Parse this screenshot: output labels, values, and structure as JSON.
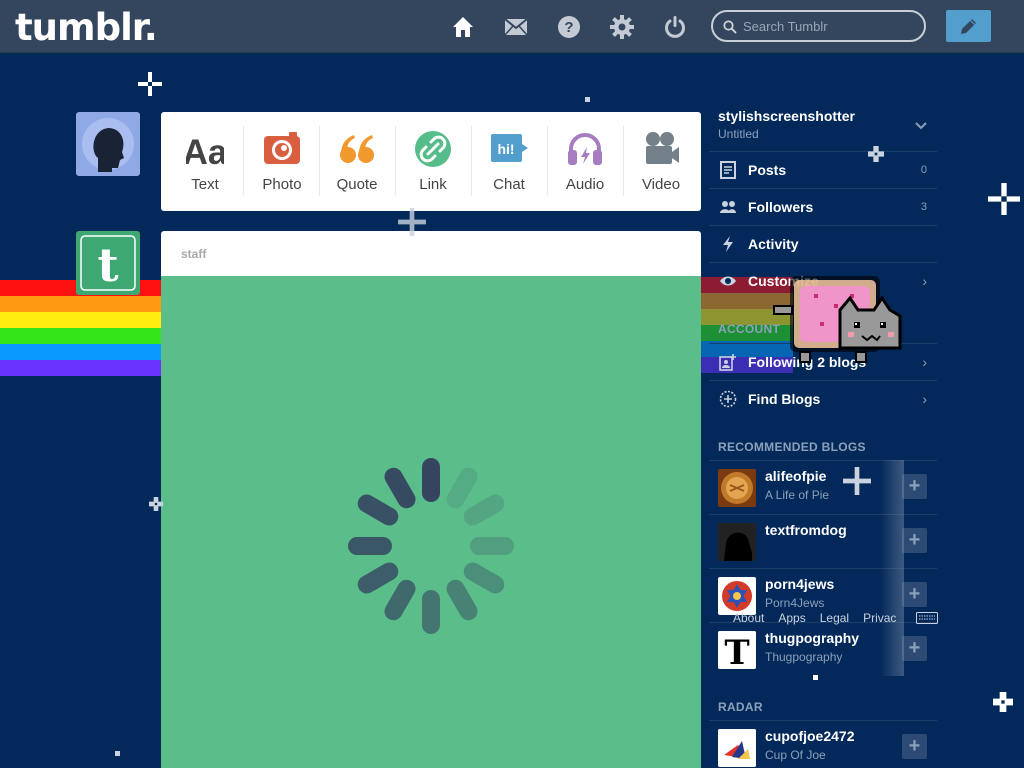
{
  "topbar": {
    "logo": "tumblr.",
    "search_placeholder": "Search Tumblr"
  },
  "post_types": [
    {
      "label": "Text",
      "icon": "text-icon"
    },
    {
      "label": "Photo",
      "icon": "camera-icon"
    },
    {
      "label": "Quote",
      "icon": "quote-icon"
    },
    {
      "label": "Link",
      "icon": "link-icon"
    },
    {
      "label": "Chat",
      "icon": "chat-icon",
      "badge": "hi!"
    },
    {
      "label": "Audio",
      "icon": "headphones-icon"
    },
    {
      "label": "Video",
      "icon": "video-camera-icon"
    }
  ],
  "post": {
    "author": "staff"
  },
  "sidebar": {
    "blog_name": "stylishscreenshotter",
    "blog_title": "Untitled",
    "menu": [
      {
        "label": "Posts",
        "count": "0",
        "icon": "posts-icon"
      },
      {
        "label": "Followers",
        "count": "3",
        "icon": "followers-icon"
      },
      {
        "label": "Activity",
        "icon": "lightning-icon"
      },
      {
        "label": "Customize",
        "icon": "eye-icon"
      }
    ],
    "account_title": "ACCOUNT",
    "account_menu": [
      {
        "label": "Following 2 blogs",
        "icon": "following-icon"
      },
      {
        "label": "Find Blogs",
        "icon": "compass-icon"
      }
    ],
    "recommended_title": "RECOMMENDED BLOGS",
    "recommended": [
      {
        "name": "alifeofpie",
        "title": "A Life of Pie"
      },
      {
        "name": "textfromdog",
        "title": ""
      },
      {
        "name": "porn4jews",
        "title": "Porn4Jews"
      },
      {
        "name": "thugpography",
        "title": "Thugpography"
      }
    ],
    "footer_links": [
      "About",
      "Apps",
      "Legal",
      "Privac"
    ],
    "radar_title": "RADAR",
    "radar": {
      "name": "cupofjoe2472",
      "title": "Cup Of Joe"
    }
  },
  "colors": {
    "background": "#03295a",
    "topbar": "#34465d",
    "compose": "#529ecc",
    "post_body": "#5bbe8a"
  }
}
